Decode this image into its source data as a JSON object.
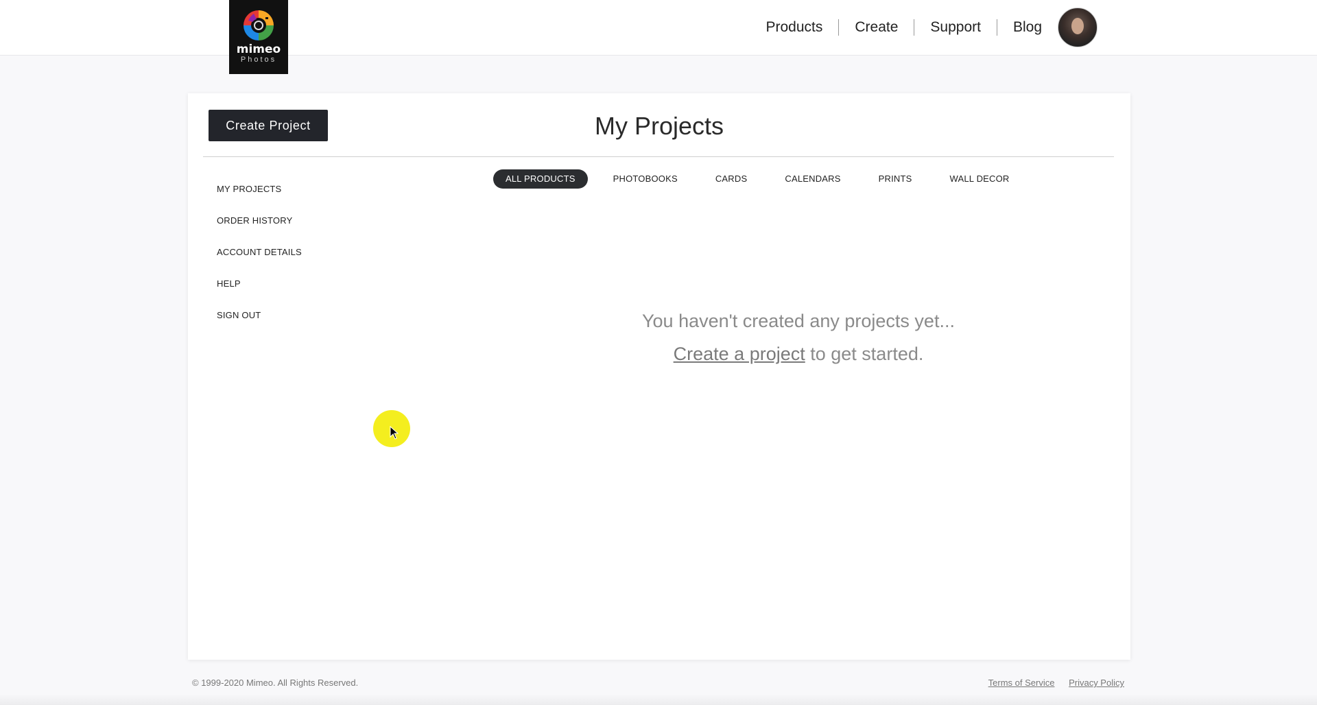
{
  "header": {
    "logo": {
      "word": "mimeo",
      "sub": "Photos",
      "icon": "camera-rainbow-logo"
    },
    "nav": [
      "Products",
      "Create",
      "Support",
      "Blog"
    ],
    "avatar_icon": "user-avatar"
  },
  "main": {
    "create_button": "Create Project",
    "title": "My Projects",
    "sidebar": [
      "MY PROJECTS",
      "ORDER HISTORY",
      "ACCOUNT DETAILS",
      "HELP",
      "SIGN OUT"
    ],
    "tabs": [
      "ALL PRODUCTS",
      "PHOTOBOOKS",
      "CARDS",
      "CALENDARS",
      "PRINTS",
      "WALL DECOR"
    ],
    "active_tab": "ALL PRODUCTS",
    "empty": {
      "line1": "You haven't created any projects yet...",
      "link": "Create a project",
      "line2_rest": " to get started."
    }
  },
  "footer": {
    "copyright": "© 1999-2020 Mimeo. All Rights Reserved.",
    "links": [
      "Terms of Service",
      "Privacy Policy"
    ]
  },
  "colors": {
    "accent_dark": "#23252b",
    "cursor_highlight": "#f4ee1f"
  }
}
